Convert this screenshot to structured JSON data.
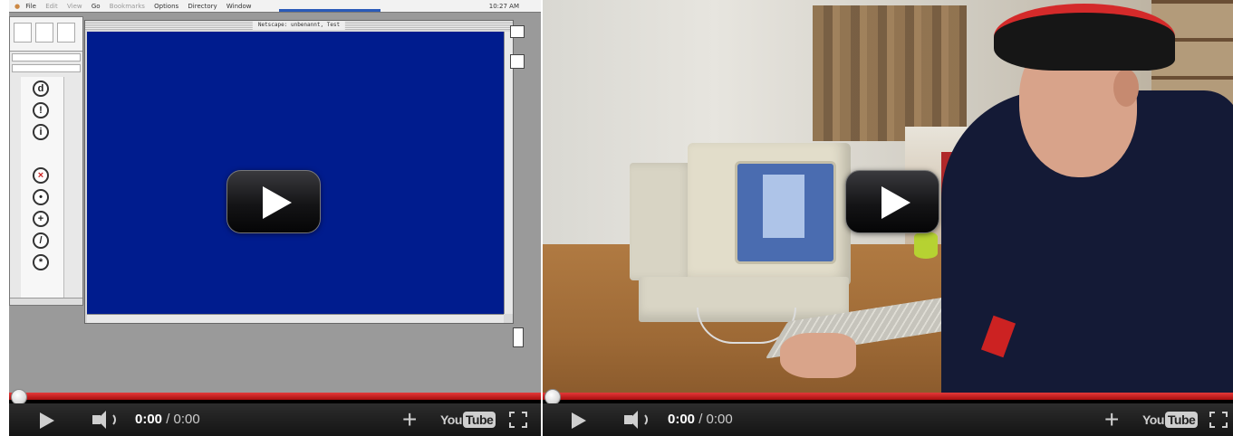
{
  "players": [
    {
      "id": "left",
      "scene": "vintage-mac-netscape-desktop",
      "menubar": {
        "items": [
          "File",
          "Edit",
          "View",
          "Go",
          "Bookmarks",
          "Options",
          "Directory",
          "Window"
        ],
        "clock": "10:27 AM"
      },
      "window_title": "Netscape: unbenannt, Test",
      "play_button_icon": "play-icon",
      "progress_fraction": 0.0,
      "time": {
        "current": "0:00",
        "separator": " / ",
        "duration": "0:00"
      },
      "controls": {
        "play_icon": "play-icon",
        "volume_icon": "volume-icon",
        "add_icon": "plus-icon",
        "logo": {
          "you": "You",
          "tube": "Tube"
        },
        "fullscreen_icon": "fullscreen-icon"
      }
    },
    {
      "id": "right",
      "scene": "man-at-vintage-mac-computer",
      "play_button_icon": "play-icon",
      "progress_fraction": 0.0,
      "time": {
        "current": "0:00",
        "separator": " / ",
        "duration": "0:00"
      },
      "controls": {
        "play_icon": "play-icon",
        "volume_icon": "volume-icon",
        "add_icon": "plus-icon",
        "logo": {
          "you": "You",
          "tube": "Tube"
        },
        "fullscreen_icon": "fullscreen-icon"
      }
    }
  ],
  "colors": {
    "progress": "#cc1e1e",
    "controlbar": "#1e1e1e",
    "netscape_content": "#001c8e"
  }
}
